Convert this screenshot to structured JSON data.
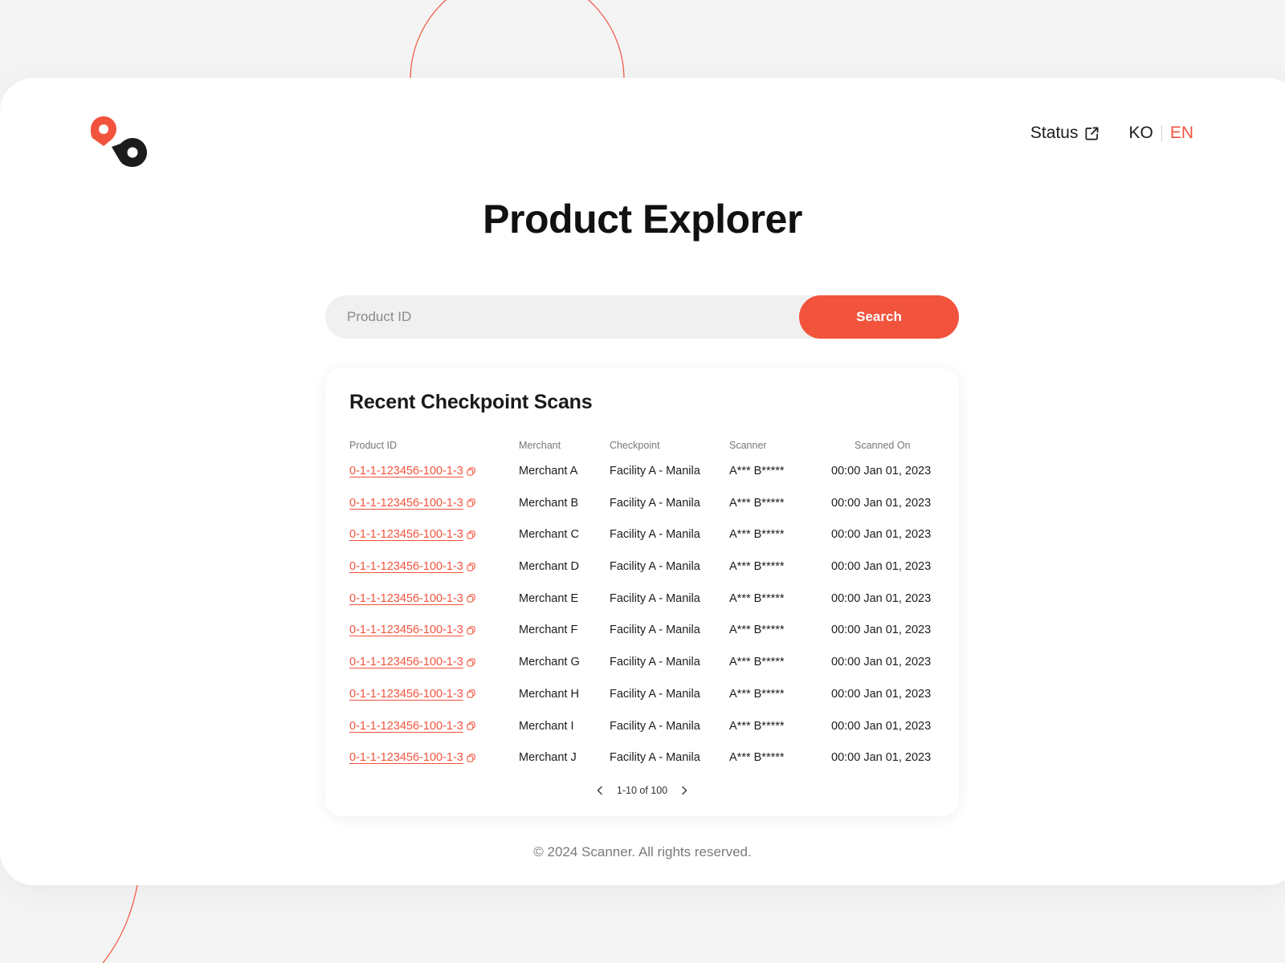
{
  "brand": {
    "logo_icon": "location-pins-logo-icon",
    "accent_color": "#f2533c",
    "dark_color": "#1c1c1c"
  },
  "nav": {
    "status_label": "Status",
    "status_icon": "external-link-icon",
    "languages": [
      {
        "code": "KO",
        "active": false
      },
      {
        "code": "EN",
        "active": true
      }
    ]
  },
  "page": {
    "title": "Product Explorer"
  },
  "search": {
    "placeholder": "Product ID",
    "value": "",
    "button_label": "Search"
  },
  "scans": {
    "title": "Recent Checkpoint Scans",
    "columns": [
      "Product ID",
      "Merchant",
      "Checkpoint",
      "Scanner",
      "Scanned On"
    ],
    "rows": [
      {
        "product_id": "0-1-1-123456-100-1-3",
        "merchant": "Merchant A",
        "checkpoint": "Facility A - Manila",
        "scanner": "A*** B*****",
        "scanned_on": "00:00 Jan 01, 2023"
      },
      {
        "product_id": "0-1-1-123456-100-1-3",
        "merchant": "Merchant B",
        "checkpoint": "Facility A - Manila",
        "scanner": "A*** B*****",
        "scanned_on": "00:00 Jan 01, 2023"
      },
      {
        "product_id": "0-1-1-123456-100-1-3",
        "merchant": "Merchant C",
        "checkpoint": "Facility A - Manila",
        "scanner": "A*** B*****",
        "scanned_on": "00:00 Jan 01, 2023"
      },
      {
        "product_id": "0-1-1-123456-100-1-3",
        "merchant": "Merchant D",
        "checkpoint": "Facility A - Manila",
        "scanner": "A*** B*****",
        "scanned_on": "00:00 Jan 01, 2023"
      },
      {
        "product_id": "0-1-1-123456-100-1-3",
        "merchant": "Merchant E",
        "checkpoint": "Facility A - Manila",
        "scanner": "A*** B*****",
        "scanned_on": "00:00 Jan 01, 2023"
      },
      {
        "product_id": "0-1-1-123456-100-1-3",
        "merchant": "Merchant F",
        "checkpoint": "Facility A - Manila",
        "scanner": "A*** B*****",
        "scanned_on": "00:00 Jan 01, 2023"
      },
      {
        "product_id": "0-1-1-123456-100-1-3",
        "merchant": "Merchant G",
        "checkpoint": "Facility A - Manila",
        "scanner": "A*** B*****",
        "scanned_on": "00:00 Jan 01, 2023"
      },
      {
        "product_id": "0-1-1-123456-100-1-3",
        "merchant": "Merchant H",
        "checkpoint": "Facility A - Manila",
        "scanner": "A*** B*****",
        "scanned_on": "00:00 Jan 01, 2023"
      },
      {
        "product_id": "0-1-1-123456-100-1-3",
        "merchant": "Merchant I",
        "checkpoint": "Facility A - Manila",
        "scanner": "A*** B*****",
        "scanned_on": "00:00 Jan 01, 2023"
      },
      {
        "product_id": "0-1-1-123456-100-1-3",
        "merchant": "Merchant J",
        "checkpoint": "Facility A - Manila",
        "scanner": "A*** B*****",
        "scanned_on": "00:00 Jan 01, 2023"
      }
    ],
    "pagination": {
      "label": "1-10 of 100",
      "prev_icon": "chevron-left-icon",
      "next_icon": "chevron-right-icon"
    }
  },
  "footer": {
    "copyright": "© 2024 Scanner. All rights reserved."
  }
}
